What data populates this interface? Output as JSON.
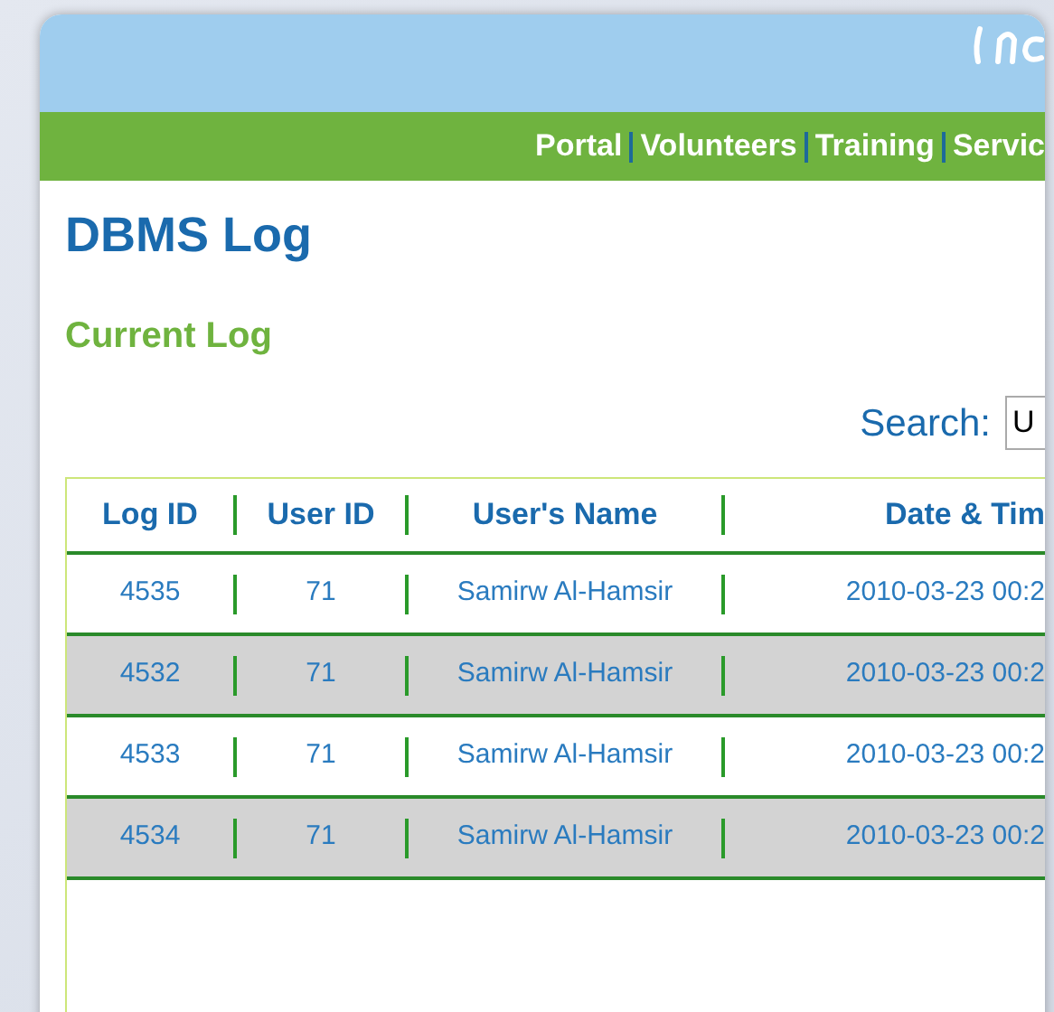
{
  "nav": {
    "links": [
      "Portal",
      "Volunteers",
      "Training",
      "Servic"
    ]
  },
  "page": {
    "title": "DBMS Log",
    "subtitle": "Current Log"
  },
  "search": {
    "label": "Search:",
    "value": "U"
  },
  "table": {
    "columns": [
      "Log ID",
      "User ID",
      "User's Name",
      "Date & Tim"
    ],
    "rows": [
      [
        "4535",
        "71",
        "Samirw Al-Hamsir",
        "2010-03-23 00:2"
      ],
      [
        "4532",
        "71",
        "Samirw Al-Hamsir",
        "2010-03-23 00:2"
      ],
      [
        "4533",
        "71",
        "Samirw Al-Hamsir",
        "2010-03-23 00:2"
      ],
      [
        "4534",
        "71",
        "Samirw Al-Hamsir",
        "2010-03-23 00:2"
      ]
    ]
  }
}
